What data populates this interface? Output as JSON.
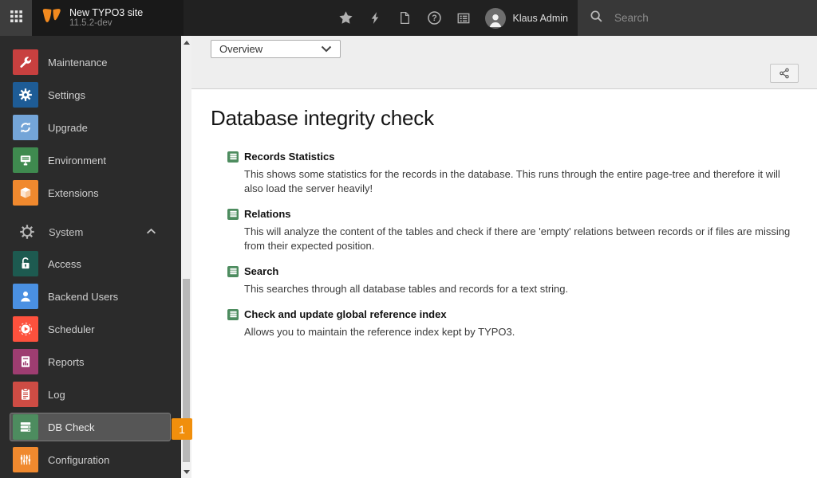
{
  "topbar": {
    "site_title": "New TYPO3 site",
    "version": "11.5.2-dev",
    "username": "Klaus Admin",
    "search": {
      "placeholder": "Search"
    }
  },
  "sidebar": {
    "group_system_label": "System",
    "items": [
      {
        "label": "Maintenance",
        "color": "#c8403f"
      },
      {
        "label": "Settings",
        "color": "#1e5c96"
      },
      {
        "label": "Upgrade",
        "color": "#74a5d8"
      },
      {
        "label": "Environment",
        "color": "#3f8a4f"
      },
      {
        "label": "Extensions",
        "color": "#f0892e"
      },
      {
        "label": "Access",
        "color": "#1d5a50"
      },
      {
        "label": "Backend Users",
        "color": "#4a90e2"
      },
      {
        "label": "Scheduler",
        "color": "#fd513d"
      },
      {
        "label": "Reports",
        "color": "#9e3d71"
      },
      {
        "label": "Log",
        "color": "#ce4c44"
      },
      {
        "label": "DB Check",
        "color": "#4d8c5f",
        "badge": "1",
        "active": true
      },
      {
        "label": "Configuration",
        "color": "#f0892e"
      }
    ]
  },
  "docheader": {
    "view_select_value": "Overview"
  },
  "main": {
    "title": "Database integrity check",
    "checks": [
      {
        "title": "Records Statistics",
        "description": "This shows some statistics for the records in the database. This runs through the entire page-tree and therefore it will also load the server heavily!"
      },
      {
        "title": "Relations",
        "description": "This will analyze the content of the tables and check if there are 'empty' relations between records or if files are missing from their expected position."
      },
      {
        "title": "Search",
        "description": "This searches through all database tables and records for a text string."
      },
      {
        "title": "Check and update global reference index",
        "description": "Allows you to maintain the reference index kept by TYPO3."
      }
    ]
  },
  "colors": {
    "brand_orange": "#f38a1f",
    "badge_orange": "#f18f0c",
    "topbar_bg": "#212121",
    "sidebar_bg": "#2b2b2b"
  }
}
